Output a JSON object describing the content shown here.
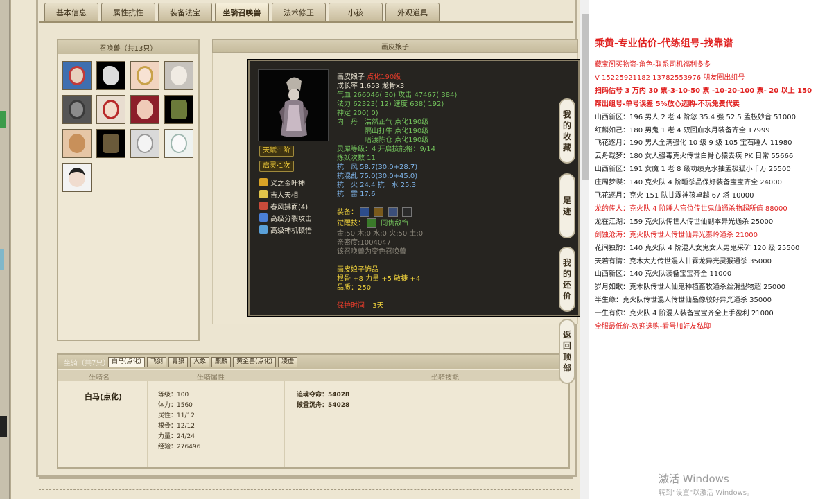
{
  "tabs": [
    "基本信息",
    "属性抗性",
    "装备法宝",
    "坐骑召唤兽",
    "法术修正",
    "小孩",
    "外观道具"
  ],
  "summon_panel": {
    "title": "召唤兽（共13只）"
  },
  "detail_header": "画皮娘子",
  "tooltip": {
    "name": "画皮娘子",
    "name_suffix": "点化190级",
    "growth": "成长率 1.653 龙骨x3",
    "hp_line": {
      "label": "气血",
      "value": "266046( 30)",
      "atk_label": "攻击",
      "atk": "47467( 384)"
    },
    "mp_line": {
      "label": "法力",
      "value": "62323( 12)",
      "spd_label": "速度",
      "spd": "638( 192)"
    },
    "god": "神定 200( 0)",
    "neidan_title": "内　丹",
    "neidan": [
      "浩然正气 点化190级",
      "隔山打牛 点化190级",
      "暗渡陈仓 点化190级"
    ],
    "talent_badge": "天赋·1阶",
    "soul_badge": "启灵·1次",
    "spirit_level": "灵犀等级：4 开启技能格：9/14",
    "refine": "炼妖次数 11",
    "resist_wind": "抗　风 58.7(30.0+28.7)",
    "resist_chaos": "抗混乱 75.0(30.0+45.0)",
    "resist_fire_water": "抗　火 24.4  抗　水 25.3",
    "resist_thunder": "抗　雷 17.6",
    "skills": [
      "义之金叶神",
      "吉人天相",
      "春风拂面(4)",
      "高级分裂攻击",
      "高级神机顿悟"
    ],
    "equip_label": "装备：",
    "awaken_label": "觉醒技：",
    "awaken_skill": "同仇敌忾",
    "elements": "金:50 木:0 水:0 火:50 土:0",
    "intimacy": "亲密度:1004047",
    "note": "该召唤兽为变色召唤兽",
    "ornament_title": "画皮娘子饰品",
    "ornament_stats": "根骨 +8 力量 +5 敏捷 +4",
    "quality": "品质：250",
    "protect_label": "保护时间",
    "protect_value": "3天"
  },
  "side_buttons": [
    {
      "label": "我的收藏"
    },
    {
      "label": "足迹"
    },
    {
      "label": "我的还价"
    },
    {
      "label": "返回顶部"
    }
  ],
  "mount_panel": {
    "title": "坐骑（共7只）",
    "tabs": [
      "白马(点化)",
      "飞剑",
      "青狼",
      "大象",
      "麒麟",
      "黄金兽(点化)",
      "凌虚"
    ],
    "columns": [
      "坐骑名",
      "坐骑属性",
      "坐骑技能"
    ],
    "mount_name": "白马(点化)",
    "stats": [
      "等级：100",
      "体力：1560",
      "灵性：11/12",
      "根骨：12/12",
      "力量：24/24",
      "经验：276496"
    ],
    "skills": [
      "追魂夺命：54028",
      "破釜沉舟：54028"
    ]
  },
  "doc": {
    "title": "乘黄-专业估价-代练组号-找靠谱",
    "lines": [
      {
        "text": "藏宝阁买物资-角色-联系司机福利多多",
        "style": "red"
      },
      {
        "text": "V 15225921182   13782553976 朋友圈出组号",
        "style": "red"
      },
      {
        "text": "扫码估号 3 万内 30 票-3-10-50 票 -10-20-100 票- 20 以上 150",
        "style": "redbold"
      },
      {
        "text": "帮出组号-单号误差 5%放心选购-不玩免费代卖",
        "style": "redbold"
      },
      {
        "text": "山西新区：196 男人 2 老 4 阶忽 35.4 强 52.5 孟极妙音 51000",
        "style": ""
      },
      {
        "text": "红麟如己：180 男鬼 1 老 4 双回血水月装备齐全 17999",
        "style": ""
      },
      {
        "text": "飞花逐月：190 男人全满强化 10 级 9 级 105 宝石睡人 11980",
        "style": ""
      },
      {
        "text": "云舟载梦：180 女人强毒克火传世白骨心猿去疾 PK 日常 55666",
        "style": ""
      },
      {
        "text": "山西新区：191 女魔 1 老 8 级功绩克水抽孟极狐小千万 25500",
        "style": ""
      },
      {
        "text": "庄周梦蝶：140 克火队 4 阶睡杀品保好装备宝宝齐全 24000",
        "style": ""
      },
      {
        "text": "飞花逐月：克火 151 队甘霖神孩卓越 67 塔 10000",
        "style": ""
      },
      {
        "text": "龙的传人：克火队 4 阶睡人宫位传世鬼仙通杀物超所值 88000",
        "style": "red"
      },
      {
        "text": "龙在江湖：159 克火队传世人传世仙副本异光通杀 25000",
        "style": ""
      },
      {
        "text": "剑蚀沧海：克火队传世人传世仙异光秦岭通杀 21000",
        "style": "red"
      },
      {
        "text": "花间独酌：140 克火队 4 阶混人女鬼女人男鬼采矿 120 级 25500",
        "style": ""
      },
      {
        "text": "天若有情：克木大力传世混人甘霖龙异光灵猴通杀 35000",
        "style": ""
      },
      {
        "text": "山西新区：140 克火队装备宝宝齐全 11000",
        "style": ""
      },
      {
        "text": "岁月如歌：克木队传世人仙鬼种植畜牧通杀丝滑型物超 25000",
        "style": ""
      },
      {
        "text": "半生缘：克火队传世混人传世仙品像较好异光通杀 35000",
        "style": ""
      },
      {
        "text": "一生有你：克火队 4 阶混人装备宝宝齐全上手盈利 21000",
        "style": ""
      },
      {
        "text": "全服最低价-欢迎选购-看号加好友私聊",
        "style": "red"
      }
    ],
    "watermark": "激活 Windows",
    "watermark_sub": "转到\"设置\"以激活 Windows。"
  }
}
